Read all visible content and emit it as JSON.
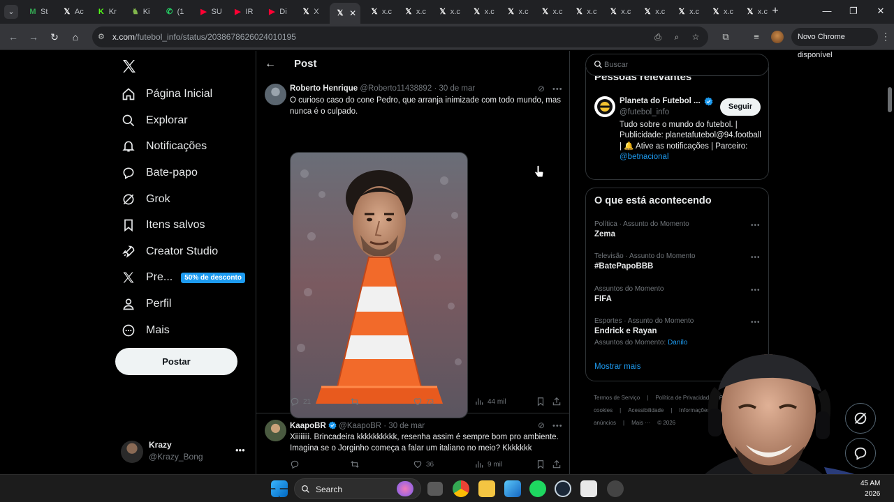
{
  "browser": {
    "tabs": [
      {
        "label": "St",
        "favicon": "gmail-icon",
        "color": "#34a853",
        "glyph": "M"
      },
      {
        "label": "Ac",
        "favicon": "x-icon",
        "color": "#ffffff",
        "glyph": "𝕏"
      },
      {
        "label": "Kr",
        "favicon": "kick-icon",
        "color": "#53fc18",
        "glyph": "K"
      },
      {
        "label": "Ki",
        "favicon": "chess-icon",
        "color": "#81b64c",
        "glyph": "♞"
      },
      {
        "label": "(1",
        "favicon": "whatsapp-icon",
        "color": "#25d366",
        "glyph": "✆"
      },
      {
        "label": "SU",
        "favicon": "youtube-icon",
        "color": "#ff0033",
        "glyph": "▶"
      },
      {
        "label": "IR",
        "favicon": "youtube-icon",
        "color": "#ff0033",
        "glyph": "▶"
      },
      {
        "label": "Di",
        "favicon": "youtube-icon",
        "color": "#ff0033",
        "glyph": "▶"
      },
      {
        "label": "X",
        "favicon": "x-icon",
        "color": "#ffffff",
        "glyph": "𝕏"
      },
      {
        "label": "",
        "favicon": "x-icon",
        "color": "#ffffff",
        "glyph": "𝕏",
        "active": true
      },
      {
        "label": "x.c",
        "favicon": "x-icon",
        "color": "#ffffff",
        "glyph": "𝕏"
      },
      {
        "label": "x.c",
        "favicon": "x-icon",
        "color": "#ffffff",
        "glyph": "𝕏"
      },
      {
        "label": "x.c",
        "favicon": "x-icon",
        "color": "#ffffff",
        "glyph": "𝕏"
      },
      {
        "label": "x.c",
        "favicon": "x-icon",
        "color": "#ffffff",
        "glyph": "𝕏"
      },
      {
        "label": "x.c",
        "favicon": "x-icon",
        "color": "#ffffff",
        "glyph": "𝕏"
      },
      {
        "label": "x.c",
        "favicon": "x-icon",
        "color": "#ffffff",
        "glyph": "𝕏"
      },
      {
        "label": "x.c",
        "favicon": "x-icon",
        "color": "#ffffff",
        "glyph": "𝕏"
      },
      {
        "label": "x.c",
        "favicon": "x-icon",
        "color": "#ffffff",
        "glyph": "𝕏"
      },
      {
        "label": "x.c",
        "favicon": "x-icon",
        "color": "#ffffff",
        "glyph": "𝕏"
      },
      {
        "label": "x.c",
        "favicon": "x-icon",
        "color": "#ffffff",
        "glyph": "𝕏"
      },
      {
        "label": "x.c",
        "favicon": "x-icon",
        "color": "#ffffff",
        "glyph": "𝕏"
      },
      {
        "label": "x.c",
        "favicon": "x-icon",
        "color": "#ffffff",
        "glyph": "𝕏"
      }
    ],
    "url_host": "x.com",
    "url_path": "/futebol_info/status/2038678626024010195",
    "update_label": "Novo Chrome disponível"
  },
  "nav": {
    "items": [
      {
        "label": "Página Inicial",
        "icon": "home-icon"
      },
      {
        "label": "Explorar",
        "icon": "search-icon"
      },
      {
        "label": "Notificações",
        "icon": "bell-icon"
      },
      {
        "label": "Bate-papo",
        "icon": "chat-icon"
      },
      {
        "label": "Grok",
        "icon": "grok-icon"
      },
      {
        "label": "Itens salvos",
        "icon": "bookmark-icon"
      },
      {
        "label": "Creator Studio",
        "icon": "rocket-icon"
      },
      {
        "label": "Pre...",
        "icon": "x-logo-icon",
        "badge": "50% de desconto"
      },
      {
        "label": "Perfil",
        "icon": "person-icon"
      },
      {
        "label": "Mais",
        "icon": "more-circle-icon"
      }
    ],
    "post_button": "Postar",
    "account": {
      "name": "Krazy",
      "handle": "@Krazy_Bong"
    }
  },
  "main": {
    "title": "Post",
    "tweets": [
      {
        "name": "Roberto Henrique",
        "handle": "@Roberto11438892",
        "date": "· 30 de mar",
        "text": "O curioso caso do cone Pedro, que arranja inimizade com todo mundo, mas nunca é o culpado.",
        "replies": "21",
        "reposts": "",
        "likes": "73",
        "views": "44 mil"
      },
      {
        "name": "KaapoBR",
        "handle": "@KaapoBR",
        "date": "· 30 de mar",
        "verified": true,
        "text": "Xiiiiiiii. Brincadeira kkkkkkkkkk, resenha assim é sempre bom pro ambiente. Imagina se o Jorginho começa a falar um italiano no meio? Kkkkkkk",
        "replies": "",
        "reposts": "",
        "likes": "36",
        "views": "9 mil"
      }
    ]
  },
  "sidebar": {
    "search_placeholder": "Buscar",
    "relevant": {
      "title": "Pessoas relevantes",
      "name": "Planeta do Futebol ...",
      "handle": "@futebol_info",
      "follow": "Seguir",
      "bio": "Tudo sobre o mundo do futebol. | Publicidade: planetafutebol@94.football | 🔔 Ative as notificações | Parceiro:",
      "bio_link": "@betnacional"
    },
    "trends_title": "O que está acontecendo",
    "trends": [
      {
        "context": "Política · Assunto do Momento",
        "name": "Zema",
        "sub": "",
        "sub_link": ""
      },
      {
        "context": "Televisão · Assunto do Momento",
        "name": "#BatePapoBBB",
        "sub": "",
        "sub_link": ""
      },
      {
        "context": "Assuntos do Momento",
        "name": "FIFA",
        "sub": "",
        "sub_link": ""
      },
      {
        "context": "Esportes · Assunto do Momento",
        "name": "Endrick e Rayan",
        "sub": "Assuntos do Momento: ",
        "sub_link": "Danilo"
      }
    ],
    "show_more": "Mostrar mais",
    "footer": [
      "Termos de Serviço",
      "|",
      "Política de Privacidade",
      "Política de cookies",
      "|",
      "Acessibilidade",
      "|",
      "Informações de anúncios",
      "|",
      "Mais ···",
      "© 2026"
    ]
  },
  "taskbar": {
    "search_placeholder": "Search",
    "time": "45 AM",
    "date": "2026"
  },
  "colors": {
    "accent": "#1d9bf0",
    "background": "#000000",
    "border": "#2f3336",
    "muted": "#71767b"
  }
}
